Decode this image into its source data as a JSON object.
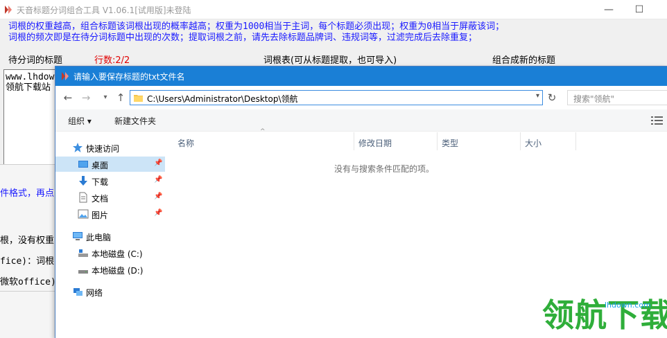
{
  "app": {
    "title": "天音标题分词组合工具 V1.06.1[试用版]未登陆",
    "minimize": "—",
    "maximize": "☐",
    "info_line1": "词根的权重越高，组合标题该词根出现的概率越高；权重为1000相当于主词，每个标题必须出现；权重为0相当于屏蔽该词；",
    "info_line2": "词根的频次即是在待分词标题中出现的次数；提取词根之前，请先去除标题品牌词、违规词等，过滤完成后去除重复；",
    "col_titles_to_split": "待分词的标题",
    "row_count": "行数:2/2",
    "col_root_table": "词根表(可从标题提取，也可导入)",
    "col_new_titles": "组合成新的标题",
    "textarea_line1": "www.lhdow",
    "textarea_line2": "领航下载站",
    "panel_line1": "件格式，再点",
    "panel_line2": "根，没有权重",
    "panel_line3": "fice)：词根",
    "panel_line4": "微软office)"
  },
  "dialog": {
    "title": "请输入要保存标题的txt文件名",
    "address": "C:\\Users\\Administrator\\Desktop\\领航",
    "search_placeholder": "搜索\"领航\"",
    "toolbar": {
      "organize": "组织 ▾",
      "new_folder": "新建文件夹"
    },
    "nav_items": [
      {
        "label": "快速访问",
        "icon": "star-icon"
      },
      {
        "label": "桌面",
        "icon": "desktop-icon",
        "pinned": true,
        "selected": true
      },
      {
        "label": "下载",
        "icon": "download-icon",
        "pinned": true
      },
      {
        "label": "文档",
        "icon": "document-icon",
        "pinned": true
      },
      {
        "label": "图片",
        "icon": "picture-icon",
        "pinned": true
      },
      {
        "label": "此电脑",
        "icon": "computer-icon"
      },
      {
        "label": "本地磁盘 (C:)",
        "icon": "drive-c-icon"
      },
      {
        "label": "本地磁盘 (D:)",
        "icon": "drive-d-icon"
      },
      {
        "label": "网络",
        "icon": "network-icon"
      }
    ],
    "columns": {
      "name": "名称",
      "modified": "修改日期",
      "type": "类型",
      "size": "大小"
    },
    "empty_message": "没有与搜索条件匹配的项。"
  },
  "watermark": {
    "logo_text": "领航下载",
    "url": "lhdown.com",
    "color": "#2fae3a"
  },
  "colors": {
    "info_text": "#1a1aff",
    "row_count": "#e00000",
    "dialog_titlebar": "#1a7fd6",
    "selected_nav": "#cce4f7"
  }
}
